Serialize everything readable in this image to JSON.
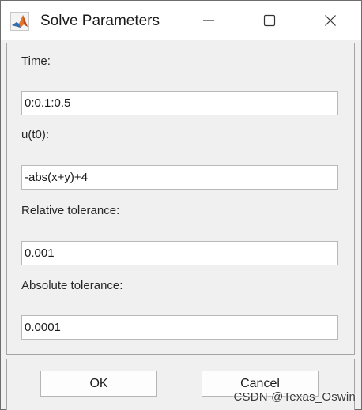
{
  "window": {
    "title": "Solve Parameters",
    "app_icon": "matlab-logo-icon",
    "controls": [
      "minimize-icon",
      "maximize-icon",
      "close-icon"
    ]
  },
  "form": {
    "time_label": "Time:",
    "time_value": "0:0.1:0.5",
    "u0_label": "u(t0):",
    "u0_value": "-abs(x+y)+4",
    "reltol_label": "Relative tolerance:",
    "reltol_value": "0.001",
    "abstol_label": "Absolute tolerance:",
    "abstol_value": "0.0001"
  },
  "buttons": {
    "ok_label": "OK",
    "cancel_label": "Cancel"
  },
  "watermark": "CSDN @Texas_Oswin"
}
